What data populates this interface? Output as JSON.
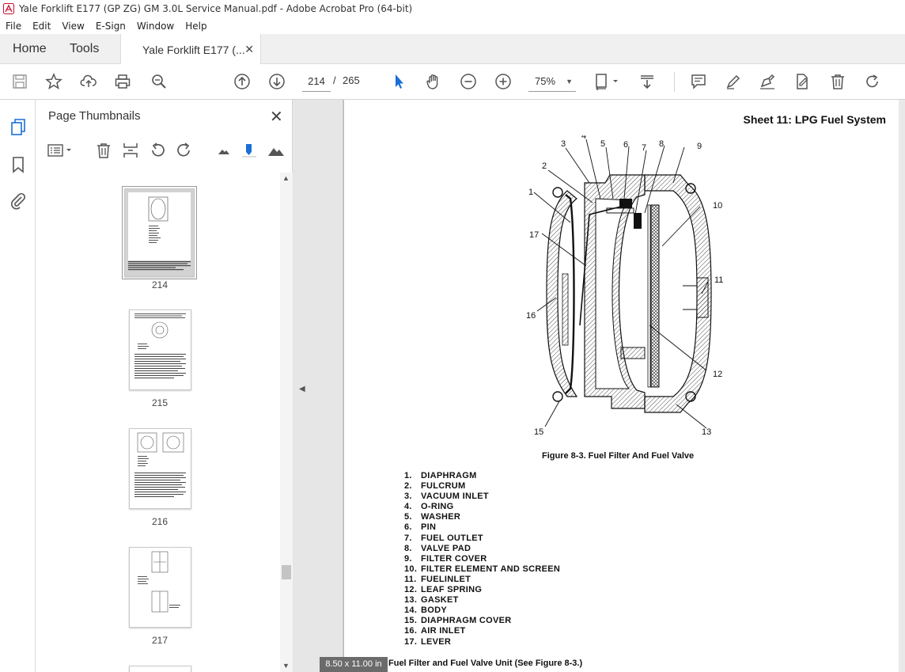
{
  "window": {
    "title": "Yale Forklift E177 (GP ZG) GM 3.0L Service Manual.pdf - Adobe Acrobat Pro (64-bit)"
  },
  "menu": [
    "File",
    "Edit",
    "View",
    "E-Sign",
    "Window",
    "Help"
  ],
  "tabs": {
    "home": "Home",
    "tools": "Tools",
    "doc": "Yale Forklift E177 (..."
  },
  "toolbar": {
    "page_current": "214",
    "page_separator": "/",
    "page_total": "265",
    "zoom": "75%"
  },
  "panel": {
    "title": "Page Thumbnails",
    "thumbnails": [
      {
        "label": "214",
        "selected": true
      },
      {
        "label": "215",
        "selected": false
      },
      {
        "label": "216",
        "selected": false
      },
      {
        "label": "217",
        "selected": false
      }
    ]
  },
  "document": {
    "sheet_title": "Sheet 11: LPG Fuel System",
    "figure_caption": "Figure 8-3. Fuel Filter And Fuel Valve",
    "callouts": [
      "1",
      "2",
      "3",
      "4",
      "5",
      "6",
      "7",
      "8",
      "9",
      "10",
      "11",
      "12",
      "13",
      "15",
      "16",
      "17"
    ],
    "legend": [
      {
        "num": "1.",
        "text": "DIAPHRAGM"
      },
      {
        "num": "2.",
        "text": "FULCRUM"
      },
      {
        "num": "3.",
        "text": "VACUUM INLET"
      },
      {
        "num": "4.",
        "text": "O-RING"
      },
      {
        "num": "5.",
        "text": "WASHER"
      },
      {
        "num": "6.",
        "text": "PIN"
      },
      {
        "num": "7.",
        "text": "FUEL OUTLET"
      },
      {
        "num": "8.",
        "text": "VALVE PAD"
      },
      {
        "num": "9.",
        "text": "FILTER COVER"
      },
      {
        "num": "10.",
        "text": "FILTER ELEMENT AND SCREEN"
      },
      {
        "num": "11.",
        "text": "FUELINLET"
      },
      {
        "num": "12.",
        "text": "LEAF SPRING"
      },
      {
        "num": "13.",
        "text": "GASKET"
      },
      {
        "num": "14.",
        "text": "BODY"
      },
      {
        "num": "15.",
        "text": "DIAPHRAGM COVER"
      },
      {
        "num": "16.",
        "text": "AIR INLET"
      },
      {
        "num": "17.",
        "text": "LEVER"
      }
    ],
    "bottom_text": "Fuel Filter and Fuel Valve Unit (See Figure 8-3.)",
    "page_size": "8.50 x 11.00 in"
  }
}
